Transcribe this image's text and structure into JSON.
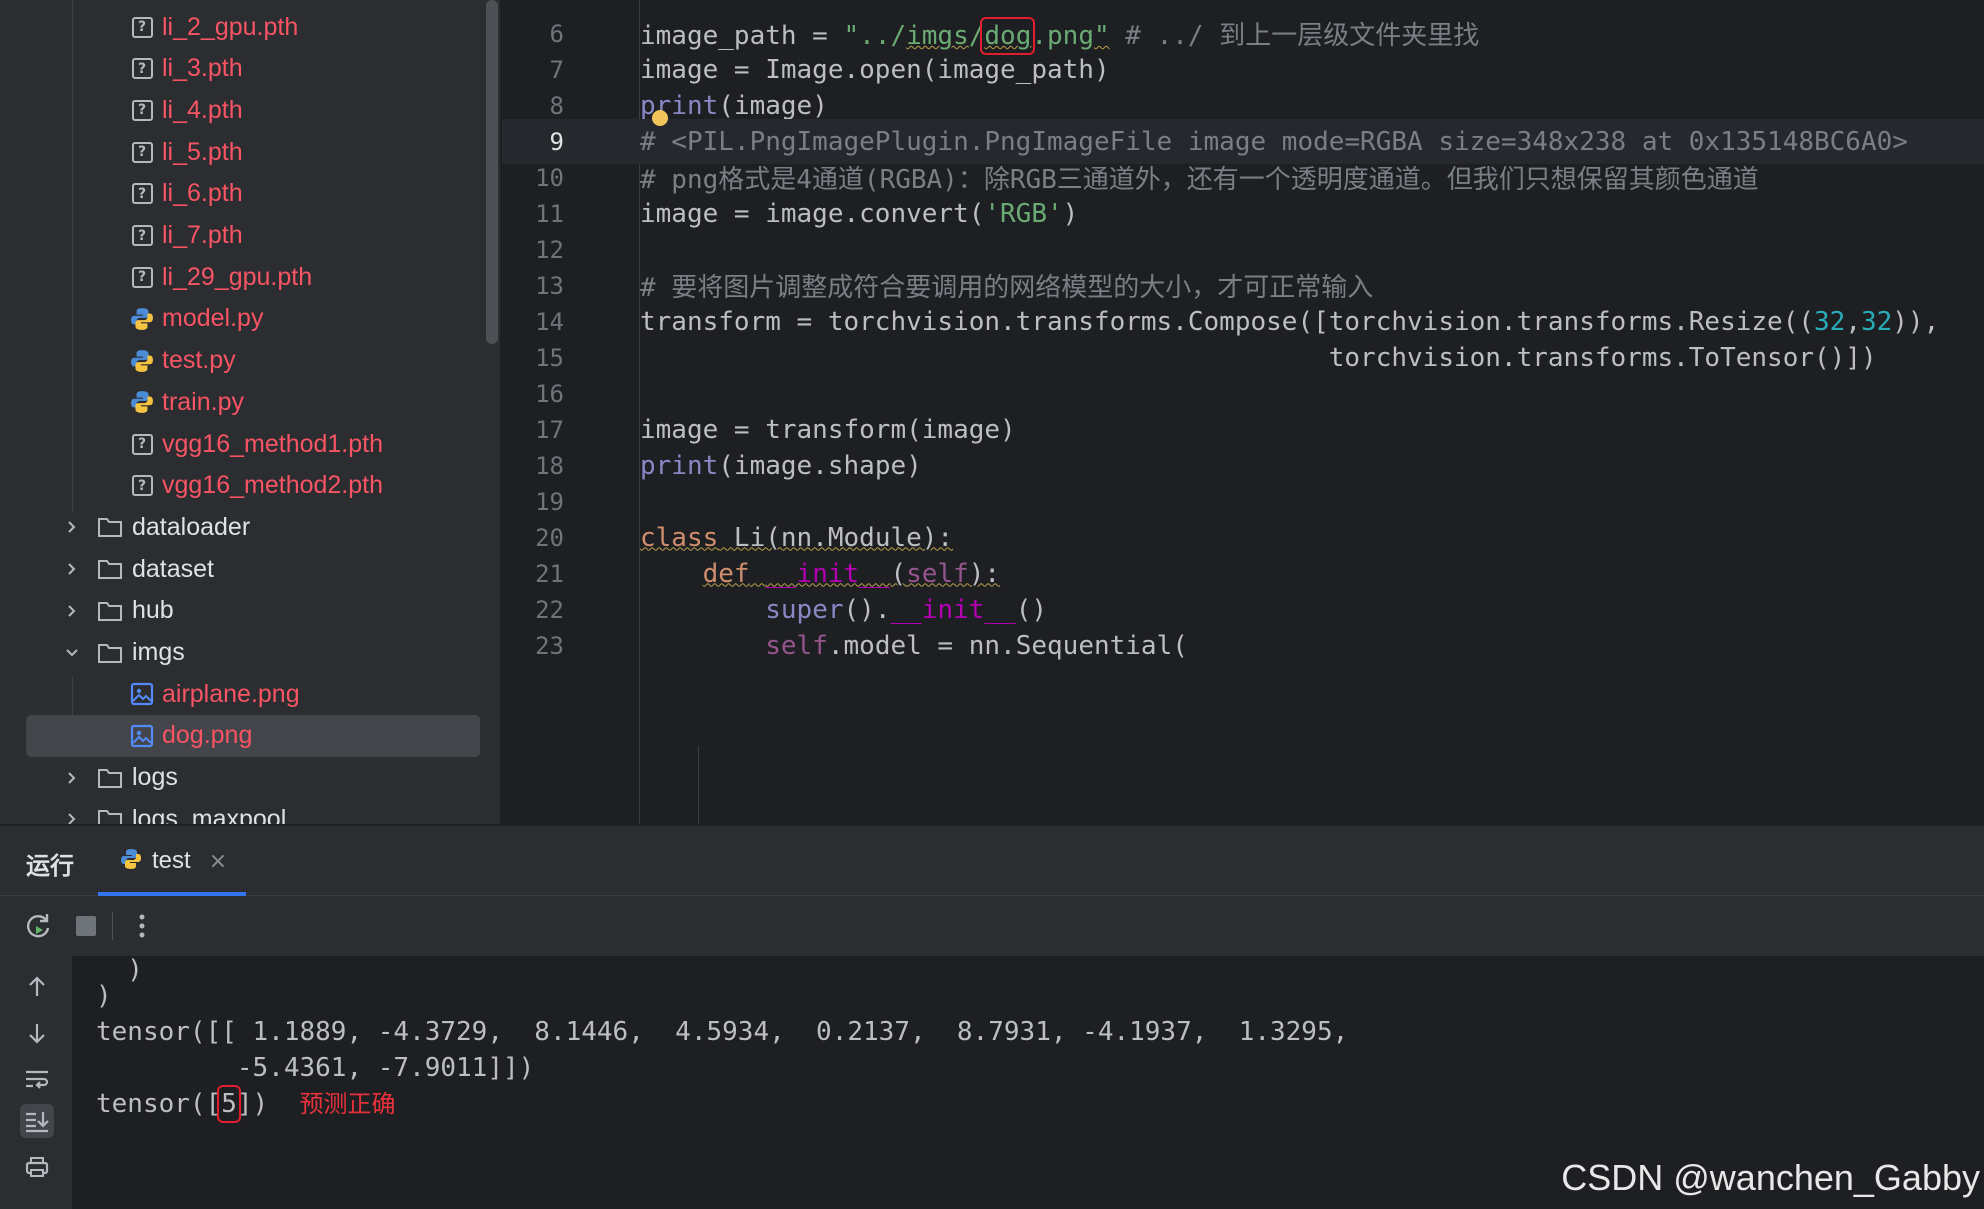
{
  "project_tree": {
    "items": [
      {
        "label": "li_2_gpu.pth",
        "type": "unknown"
      },
      {
        "label": "li_3.pth",
        "type": "unknown"
      },
      {
        "label": "li_4.pth",
        "type": "unknown"
      },
      {
        "label": "li_5.pth",
        "type": "unknown"
      },
      {
        "label": "li_6.pth",
        "type": "unknown"
      },
      {
        "label": "li_7.pth",
        "type": "unknown"
      },
      {
        "label": "li_29_gpu.pth",
        "type": "unknown"
      },
      {
        "label": "model.py",
        "type": "python"
      },
      {
        "label": "test.py",
        "type": "python"
      },
      {
        "label": "train.py",
        "type": "python"
      },
      {
        "label": "vgg16_method1.pth",
        "type": "unknown"
      },
      {
        "label": "vgg16_method2.pth",
        "type": "unknown"
      },
      {
        "label": "dataloader",
        "type": "folder"
      },
      {
        "label": "dataset",
        "type": "folder"
      },
      {
        "label": "hub",
        "type": "folder"
      },
      {
        "label": "imgs",
        "type": "folder",
        "expanded": true
      },
      {
        "label": "airplane.png",
        "type": "image"
      },
      {
        "label": "dog.png",
        "type": "image",
        "selected": true
      },
      {
        "label": "logs",
        "type": "folder"
      },
      {
        "label": "logs_maxpool",
        "type": "folder"
      }
    ]
  },
  "editor": {
    "lines": [
      {
        "n": "6",
        "segs": [
          [
            "",
            "image_path = "
          ],
          [
            "str",
            "\"../"
          ],
          [
            "str squig",
            "imgs"
          ],
          [
            "str",
            "/"
          ],
          [
            "str redbox squig",
            "dog"
          ],
          [
            "str",
            ".png"
          ],
          [
            "str squig",
            "\""
          ],
          [
            "cmt",
            " # ../ 到上一层级文件夹里找"
          ]
        ]
      },
      {
        "n": "7",
        "segs": [
          [
            "",
            "image = Image.open(image_path)"
          ]
        ]
      },
      {
        "n": "8",
        "segs": [
          [
            "builtin",
            "print"
          ],
          [
            "",
            "(image)"
          ]
        ]
      },
      {
        "n": "9",
        "segs": [
          [
            "cmt",
            "# <PIL.PngImagePlugin.PngImageFile image mode=RGBA size=348x238 at 0x135148BC6A0>"
          ]
        ],
        "current": true
      },
      {
        "n": "10",
        "segs": [
          [
            "cmt",
            "# png格式是4通道(RGBA)：除RGB三通道外，还有一个透明度通道。但我们只想保留其颜色通道"
          ]
        ]
      },
      {
        "n": "11",
        "segs": [
          [
            "",
            "image = image.convert("
          ],
          [
            "str",
            "'RGB'"
          ],
          [
            "",
            ")"
          ]
        ]
      },
      {
        "n": "12",
        "segs": []
      },
      {
        "n": "13",
        "segs": [
          [
            "cmt",
            "# 要将图片调整成符合要调用的网络模型的大小，才可正常输入"
          ]
        ]
      },
      {
        "n": "14",
        "segs": [
          [
            "",
            "transform = torchvision.transforms.Compose([torchvision.transforms.Resize(("
          ],
          [
            "num",
            "32"
          ],
          [
            "",
            ","
          ],
          [
            "num",
            "32"
          ],
          [
            "",
            ")),"
          ]
        ]
      },
      {
        "n": "15",
        "segs": [
          [
            "",
            "                                            torchvision.transforms.ToTensor()])"
          ]
        ]
      },
      {
        "n": "16",
        "segs": []
      },
      {
        "n": "17",
        "segs": [
          [
            "",
            "image = transform(image)"
          ]
        ]
      },
      {
        "n": "18",
        "segs": [
          [
            "builtin",
            "print"
          ],
          [
            "",
            "(image.shape)"
          ]
        ]
      },
      {
        "n": "19",
        "segs": []
      },
      {
        "n": "20",
        "segs": [
          [
            "kw squig",
            "class"
          ],
          [
            "squig",
            " Li(nn.Module):"
          ]
        ]
      },
      {
        "n": "21",
        "segs": [
          [
            "",
            "    "
          ],
          [
            "kw squig",
            "def"
          ],
          [
            "squig",
            " "
          ],
          [
            "magic squig",
            "__init__"
          ],
          [
            "squig",
            "("
          ],
          [
            "self squig",
            "self"
          ],
          [
            "squig",
            "):"
          ]
        ]
      },
      {
        "n": "22",
        "segs": [
          [
            "",
            "        "
          ],
          [
            "builtin",
            "super"
          ],
          [
            "",
            "()."
          ],
          [
            "magic",
            "__init__"
          ],
          [
            "",
            "()"
          ]
        ]
      },
      {
        "n": "23",
        "segs": [
          [
            "",
            "        "
          ],
          [
            "self",
            "self"
          ],
          [
            "",
            ".model = nn.Sequential("
          ]
        ]
      }
    ]
  },
  "run_panel": {
    "title": "运行",
    "tab_label": "test",
    "tab_close": "×",
    "console": {
      "line1": "  )",
      "line2": ")",
      "line3": "tensor([[ 1.1889, -4.3729,  8.1446,  4.5934,  0.2137,  8.7931, -4.1937,  1.3295,",
      "line4": "         -5.4361, -7.9011]])",
      "line5_prefix": "tensor([",
      "line5_value": "5",
      "line5_suffix": "])",
      "annotation": "预测正确"
    }
  },
  "watermark": "CSDN @wanchen_Gabby"
}
